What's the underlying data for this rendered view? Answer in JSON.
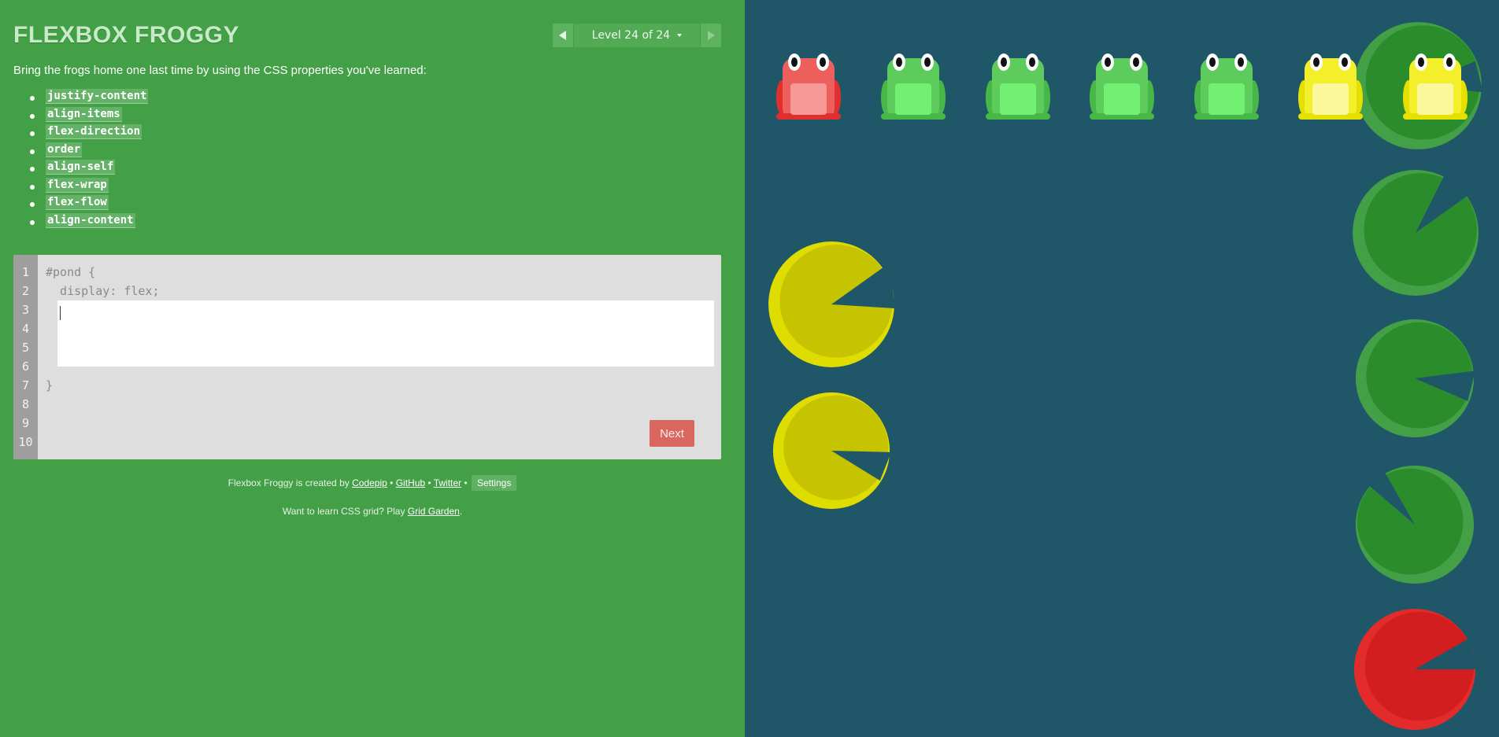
{
  "header": {
    "title": "FLEXBOX FROGGY",
    "level_label": "Level 24 of 24"
  },
  "instructions": "Bring the frogs home one last time by using the CSS properties you've learned:",
  "properties": [
    "justify-content",
    "align-items",
    "flex-direction",
    "order",
    "align-self",
    "flex-wrap",
    "flex-flow",
    "align-content"
  ],
  "editor": {
    "line_numbers": [
      "1",
      "2",
      "3",
      "4",
      "5",
      "6",
      "7",
      "8",
      "9",
      "10"
    ],
    "code_before": [
      "#pond {",
      "  display: flex;"
    ],
    "code_after": [
      "}"
    ],
    "input_value": "",
    "next_label": "Next"
  },
  "footer": {
    "created_by_prefix": "Flexbox Froggy is created by",
    "codepip": "Codepip",
    "bullet": "•",
    "github": "GitHub",
    "twitter": "Twitter",
    "settings": "Settings",
    "grid_prefix": "Want to learn CSS grid? Play",
    "grid_link": "Grid Garden",
    "grid_suffix": "."
  },
  "pond": {
    "frogs": [
      "red",
      "green",
      "green",
      "green",
      "green",
      "yellow",
      "yellow"
    ],
    "lilypads": [
      "green",
      "green",
      "green",
      "green",
      "red",
      "yellow",
      "yellow"
    ]
  },
  "colors": {
    "sidebar": "#43a047",
    "pond": "#1f5768",
    "frog_red": "#ec5f5c",
    "frog_green": "#5dcc5d",
    "frog_yellow": "#f3ef2a",
    "pad_green": "#2a8c2a",
    "pad_red": "#d21e1e",
    "pad_yellow": "#c6c300"
  }
}
